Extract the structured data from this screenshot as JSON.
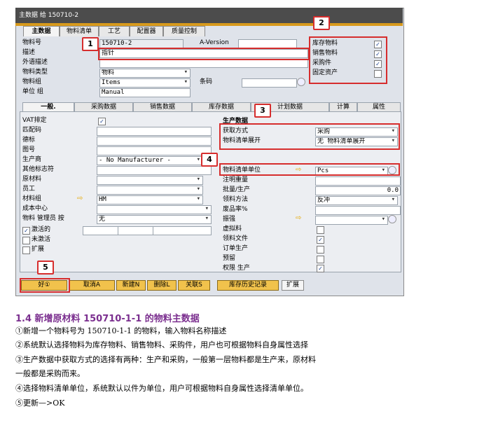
{
  "window": {
    "title": "主数据 给 150710-2"
  },
  "tabs_top": [
    "主数据",
    "物料清单",
    "工艺",
    "配置器",
    "质量控制"
  ],
  "header": {
    "item_no_label": "物料号",
    "item_no_value": "150710-2",
    "version_label": "A-Version",
    "description_label": "描述",
    "description_value": "指针",
    "foreign_desc_label": "外语描述",
    "item_type_label": "物料类型",
    "item_type_value": "物料",
    "item_group_label": "物料组",
    "item_group_value": "Items",
    "barcode_label": "条码",
    "uom_group_label": "单位 组",
    "uom_group_value": "Manual"
  },
  "flags": [
    {
      "label": "库存物料",
      "checked": true
    },
    {
      "label": "销售物料",
      "checked": true
    },
    {
      "label": "采购件",
      "checked": true
    },
    {
      "label": "固定资产",
      "checked": false
    }
  ],
  "tabs_sub": [
    "一般.",
    "采购数据",
    "销售数据",
    "库存数据",
    "计划数据",
    "计算",
    "属性"
  ],
  "general": {
    "vat_label": "VAT排定",
    "match_code_label": "匹配码",
    "remarks_label": "德标",
    "drawing_label": "图号",
    "manufacturer_label": "生产商",
    "manufacturer_value": "- No Manufacturer -",
    "other_label": "其他标志符",
    "raw_material_label": "原材料",
    "employee_label": "员工",
    "material_group_label": "材料组",
    "material_group_value": "HM",
    "cost_center_label": "成本中心",
    "item_manager_label": "物料 管理员 按",
    "item_manager_value": "无",
    "active_label": "激活的",
    "inactive_label": "未激活",
    "extended_label": "扩展"
  },
  "production": {
    "section_title": "生产数据",
    "procurement_label": "获取方式",
    "procurement_value": "采购",
    "bom_expand_label": "物料清单展开",
    "bom_expand_value": "无 物料清单展开",
    "bom_uom_label": "物料清单单位",
    "bom_uom_value": "Pcs",
    "note_weight_label": "注明重量",
    "batch_label": "批量/生产",
    "batch_value": "0.0",
    "issue_method_label": "领料方法",
    "issue_method_value": "反冲",
    "scrap_label": "废品率%",
    "gradient_label": "振强",
    "phantom_label": "虚拟料",
    "issue_doc_label": "领料文件",
    "order_prod_label": "订单生产",
    "reserve_label": "预留",
    "auth_prod_label": "权限 生产"
  },
  "buttons": [
    "好①",
    "取消A",
    "新建N",
    "删除L",
    "关联S",
    "库存历史记录",
    "扩展"
  ],
  "badges": [
    "1",
    "2",
    "3",
    "4",
    "5"
  ],
  "doc": {
    "heading": "1.4 新增原材料 150710-1-1 的物料主数据",
    "lines": [
      "①新增一个物料号为 150710-1-1 的物料，输入物料名称描述",
      "②系统默认选择物料为库存物料、销售物料、采购件，用户也可根据物料自身属性选择",
      "③生产数据中获取方式的选择有两种：生产和采购，一般第一层物料都是生产来，原材料",
      "一般都是采购而来。",
      "④选择物料清单单位，系统默认以件为单位，用户可根据物料自身属性选择清单单位。",
      "⑤更新—>OK"
    ]
  },
  "colors": {
    "accent": "#d62d2d",
    "heading": "#7b2f8f",
    "button": "#f1c24c"
  }
}
